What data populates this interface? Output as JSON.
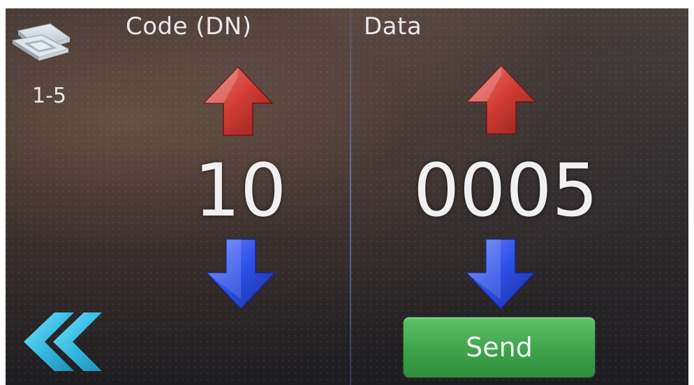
{
  "header": {
    "code_label": "Code (DN)",
    "data_label": "Data"
  },
  "unit": {
    "icon": "cassette-ac-unit-icon",
    "label": "1-5"
  },
  "code": {
    "value": "10",
    "up_icon": "red-up-arrow-icon",
    "down_icon": "blue-down-arrow-icon"
  },
  "data": {
    "value": "0005",
    "up_icon": "red-up-arrow-icon",
    "down_icon": "blue-down-arrow-icon"
  },
  "buttons": {
    "back_icon": "double-chevron-left-icon",
    "send_label": "Send"
  },
  "colors": {
    "up_arrow": "#d8453f",
    "down_arrow": "#2f4fe0",
    "back_arrow": "#39c3e6",
    "send_button": "#43a84f",
    "divider": "#6f8cd0"
  }
}
